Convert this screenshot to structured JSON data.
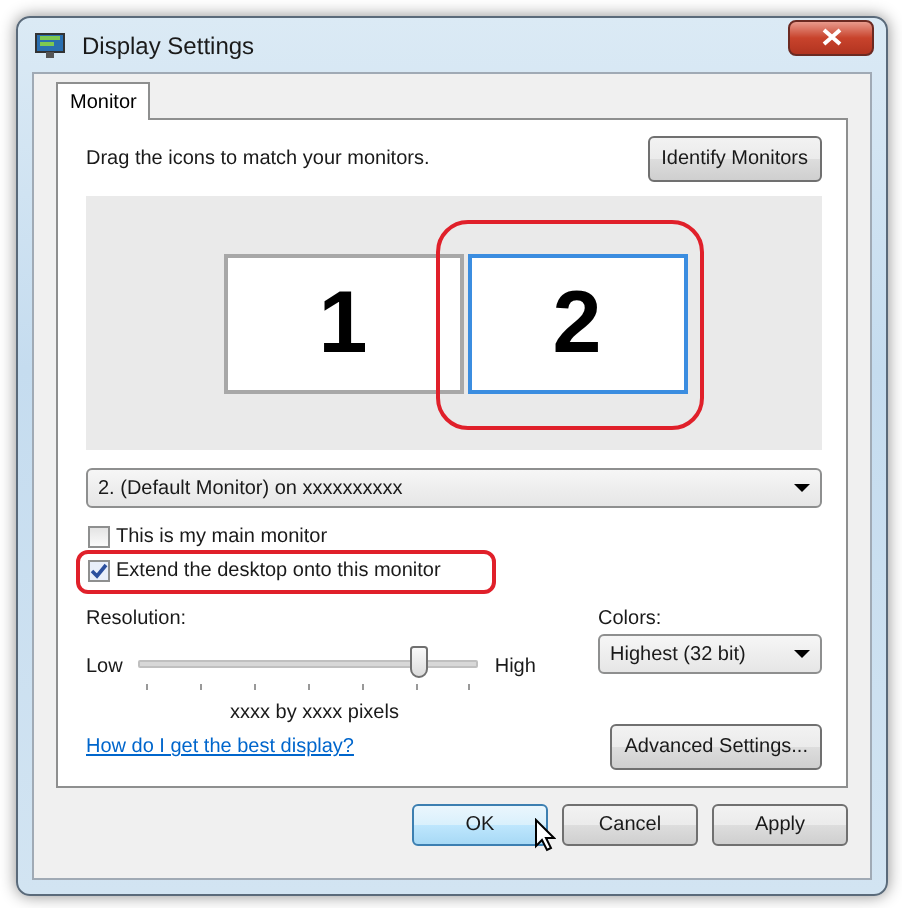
{
  "window": {
    "title": "Display Settings"
  },
  "tabs": [
    {
      "label": "Monitor",
      "selected": true
    }
  ],
  "instruction": "Drag the icons to match your monitors.",
  "identify_button": "Identify Monitors",
  "monitors": [
    {
      "label": "1",
      "selected": false,
      "annotated": false
    },
    {
      "label": "2",
      "selected": true,
      "annotated": true
    }
  ],
  "monitor_dropdown": {
    "value": "2. (Default Monitor) on xxxxxxxxxx"
  },
  "checkboxes": [
    {
      "label": "This is my main monitor",
      "checked": false,
      "annotated": false
    },
    {
      "label": "Extend the desktop onto this monitor",
      "checked": true,
      "annotated": true
    }
  ],
  "resolution": {
    "label": "Resolution:",
    "low": "Low",
    "high": "High",
    "level": 0.83,
    "reading": "xxxx by xxxx pixels"
  },
  "colors": {
    "label": "Colors:",
    "value": "Highest (32 bit)"
  },
  "help_link": "How do I get the best display?",
  "advanced_button": "Advanced Settings...",
  "buttons": [
    {
      "label": "OK",
      "default": true
    },
    {
      "label": "Cancel",
      "default": false
    },
    {
      "label": "Apply",
      "default": false
    }
  ]
}
